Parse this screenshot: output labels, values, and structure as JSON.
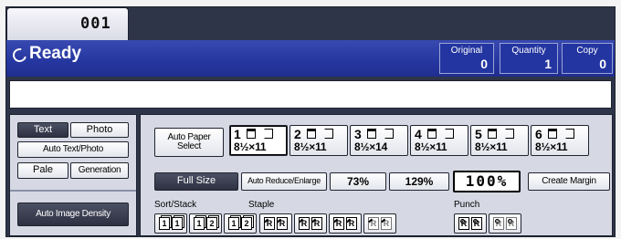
{
  "job": {
    "number": "001"
  },
  "status": {
    "ready": "Ready",
    "original_label": "Original",
    "original_value": "0",
    "quantity_label": "Quantity",
    "quantity_value": "1",
    "copy_label": "Copy",
    "copy_value": "0"
  },
  "message": "",
  "left_panel": {
    "text": "Text",
    "photo": "Photo",
    "auto_text_photo": "Auto Text/Photo",
    "pale": "Pale",
    "generation": "Generation",
    "auto_image_density": "Auto Image Density"
  },
  "paper": {
    "auto_paper_select": "Auto Paper Select",
    "trays": [
      {
        "num": "1",
        "size": "8½×11"
      },
      {
        "num": "2",
        "size": "8½×11"
      },
      {
        "num": "3",
        "size": "8½×14"
      },
      {
        "num": "4",
        "size": "8½×11"
      },
      {
        "num": "5",
        "size": "8½×11"
      },
      {
        "num": "6",
        "size": "8½×11"
      }
    ]
  },
  "reduce_enlarge": {
    "full_size": "Full Size",
    "auto_reduce_enlarge": "Auto Reduce/Enlarge",
    "r73": "73%",
    "r129": "129%",
    "ratio": "100%",
    "create_margin": "Create Margin"
  },
  "finishing": {
    "sort_stack": "Sort/Stack",
    "staple": "Staple",
    "punch": "Punch"
  },
  "colors": {
    "ready_band": "#2636a0",
    "frame": "#2f3548",
    "panel": "#d6d9e4"
  }
}
